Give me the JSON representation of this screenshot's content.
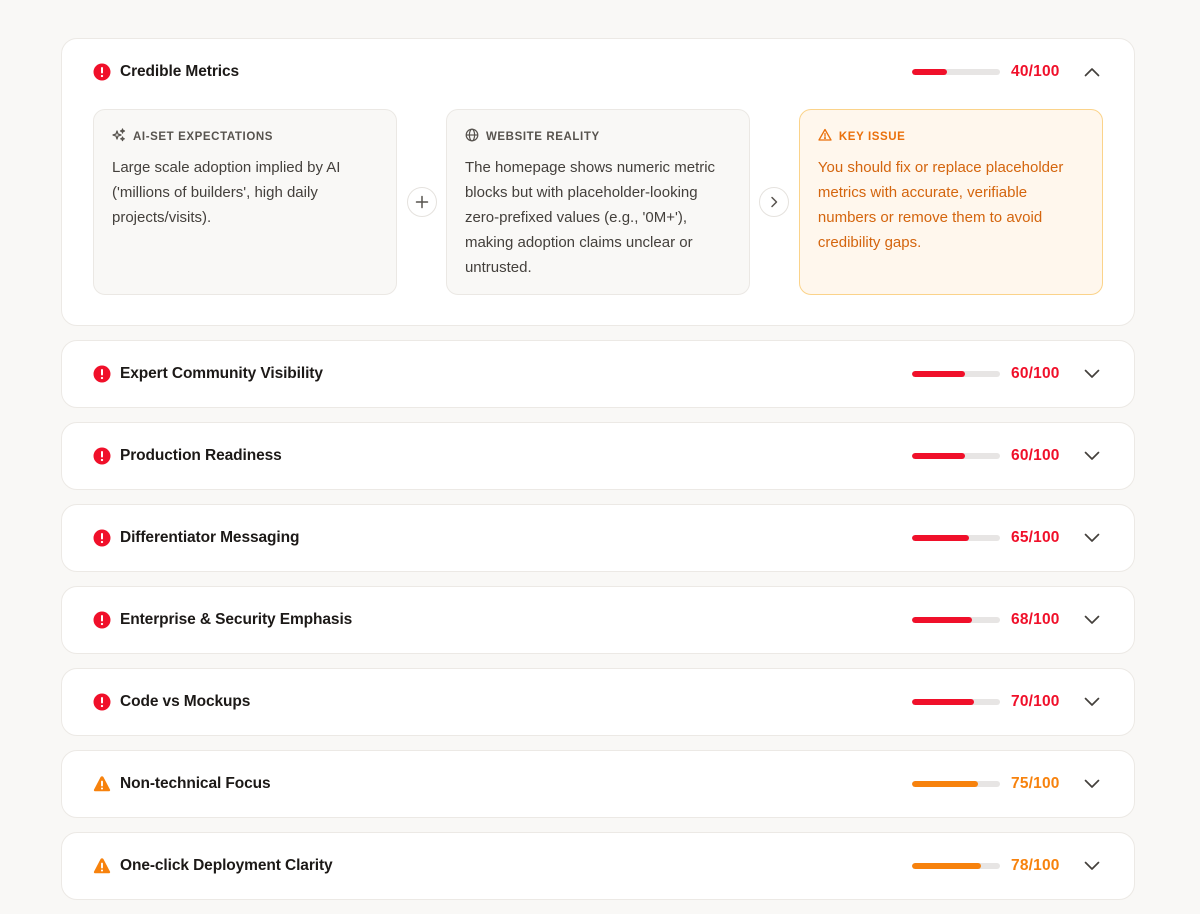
{
  "expanded_item": {
    "title": "Credible Metrics",
    "score_text": "40/100",
    "score": 40,
    "severity": "critical",
    "panels": {
      "expectation": {
        "icon": "sparkles-icon",
        "heading": "AI-SET EXPECTATIONS",
        "text": "Large scale adoption implied by AI ('millions of builders', high daily projects/visits)."
      },
      "reality": {
        "icon": "globe-icon",
        "heading": "WEBSITE REALITY",
        "text": "The homepage shows numeric metric blocks but with placeholder-looking zero-prefixed values (e.g., '0M+'), making adoption claims unclear or untrusted."
      },
      "issue": {
        "icon": "warning-triangle-icon",
        "heading": "KEY ISSUE",
        "text": "You should fix or replace placeholder metrics with accurate, verifiable numbers or remove them to avoid credibility gaps."
      }
    }
  },
  "items": [
    {
      "title": "Expert Community Visibility",
      "score_text": "60/100",
      "score": 60,
      "severity": "critical"
    },
    {
      "title": "Production Readiness",
      "score_text": "60/100",
      "score": 60,
      "severity": "critical"
    },
    {
      "title": "Differentiator Messaging",
      "score_text": "65/100",
      "score": 65,
      "severity": "critical"
    },
    {
      "title": "Enterprise & Security Emphasis",
      "score_text": "68/100",
      "score": 68,
      "severity": "critical"
    },
    {
      "title": "Code vs Mockups",
      "score_text": "70/100",
      "score": 70,
      "severity": "critical"
    },
    {
      "title": "Non-technical Focus",
      "score_text": "75/100",
      "score": 75,
      "severity": "warning"
    },
    {
      "title": "One-click Deployment Clarity",
      "score_text": "78/100",
      "score": 78,
      "severity": "warning"
    }
  ],
  "colors": {
    "critical": "#f0102a",
    "warning": "#f7820d",
    "issue_bg": "#fff7ed",
    "issue_border": "#fbd38a"
  }
}
